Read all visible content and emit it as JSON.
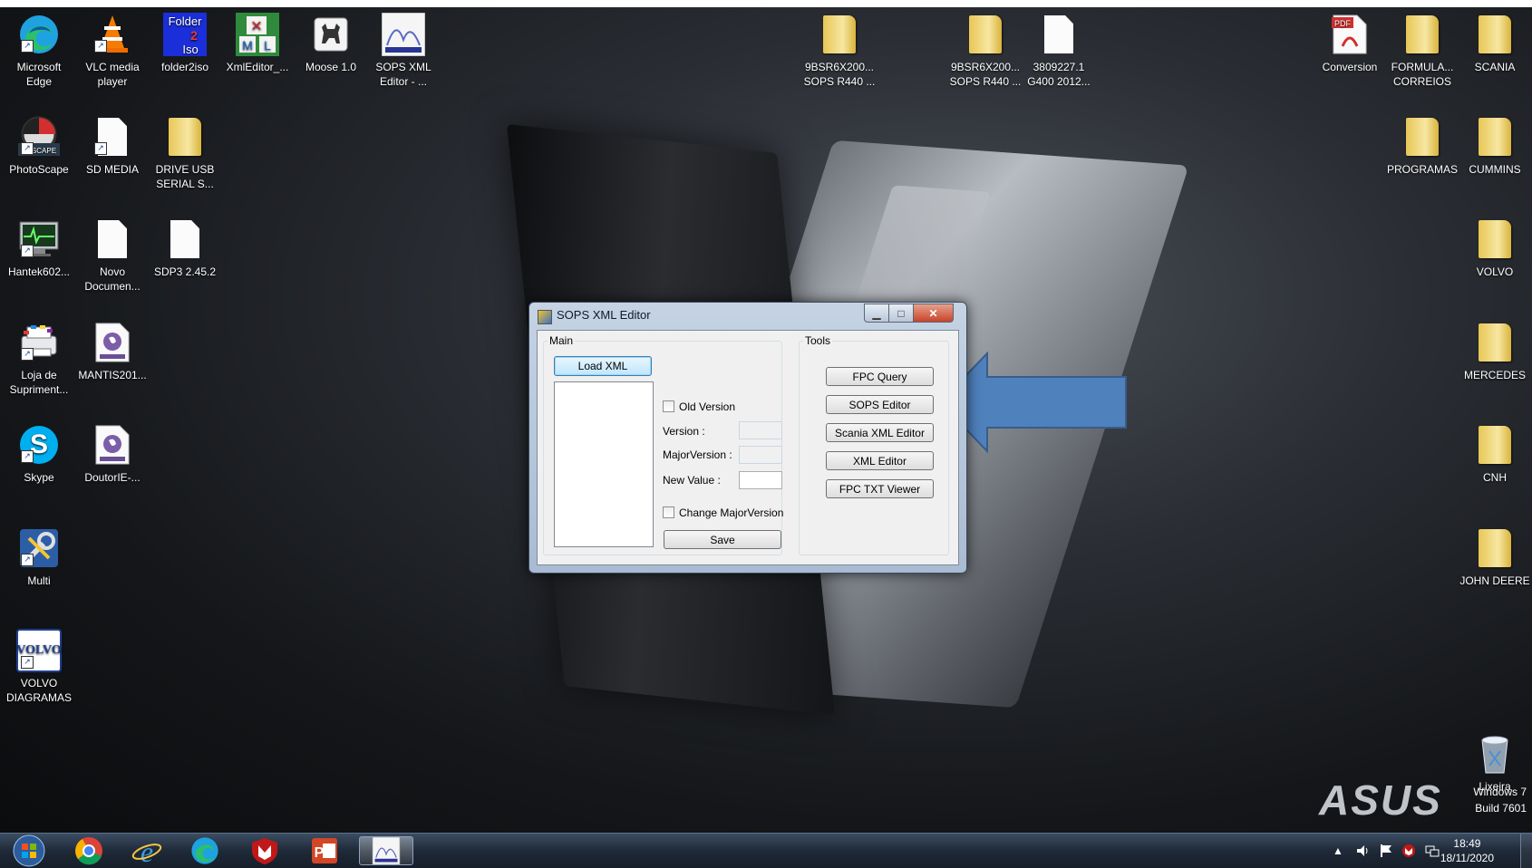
{
  "desktop": {
    "brand": "ASUS",
    "windows_info": [
      "Windows 7",
      "Build 7601"
    ],
    "icons": [
      {
        "label": "Microsoft\nEdge"
      },
      {
        "label": "VLC media\nplayer"
      },
      {
        "label": "folder2iso"
      },
      {
        "label": "XmlEditor_..."
      },
      {
        "label": "Moose 1.0"
      },
      {
        "label": "SOPS XML\nEditor - ..."
      },
      {
        "label": "PhotoScape"
      },
      {
        "label": "SD MEDIA"
      },
      {
        "label": "DRIVE USB\nSERIAL S..."
      },
      {
        "label": "Hantek602..."
      },
      {
        "label": "Novo\nDocumen..."
      },
      {
        "label": "SDP3 2.45.2"
      },
      {
        "label": "Loja de\nSupriment..."
      },
      {
        "label": "MANTIS201..."
      },
      {
        "label": "Skype"
      },
      {
        "label": "DoutorIE-..."
      },
      {
        "label": "Multi"
      },
      {
        "label": "VOLVO\nDIAGRAMAS"
      },
      {
        "label": "9BSR6X200...\nSOPS R440 ..."
      },
      {
        "label": "9BSR6X200...\nSOPS R440 ..."
      },
      {
        "label": "3809227.1\nG400 2012..."
      },
      {
        "label": "Conversion"
      },
      {
        "label": "FORMULA...\nCORREIOS"
      },
      {
        "label": "SCANIA"
      },
      {
        "label": "PROGRAMAS"
      },
      {
        "label": "CUMMINS"
      },
      {
        "label": "VOLVO"
      },
      {
        "label": "MERCEDES"
      },
      {
        "label": "CNH"
      },
      {
        "label": "JOHN DEERE"
      },
      {
        "label": "Lixeira"
      }
    ],
    "icon_glyphs": {
      "folder2iso_top": "Folder",
      "folder2iso_mid": "2",
      "folder2iso_bot": "Iso",
      "volvo_logo": "VOLVO",
      "pdf_badge": "PDF",
      "skype_letter": "S",
      "photoscape_text": "TOSCAPE"
    }
  },
  "dialog": {
    "title": "SOPS XML Editor",
    "window_controls": {
      "minimize": "▁",
      "maximize": "□",
      "close": "✕"
    },
    "main_group": {
      "label": "Main",
      "load_button": "Load XML",
      "old_version_label": "Old Version",
      "version_label": "Version :",
      "major_version_label": "MajorVersion :",
      "new_value_label": "New Value :",
      "change_major_label": "Change MajorVersion",
      "save_button": "Save"
    },
    "tools_group": {
      "label": "Tools",
      "buttons": [
        "FPC Query",
        "SOPS Editor",
        "Scania XML Editor",
        "XML Editor",
        "FPC TXT Viewer"
      ]
    }
  },
  "annotation": {
    "arrow_color": "#4f81bd",
    "arrow_border": "#385d8a"
  },
  "taskbar": {
    "clock_time": "18:49",
    "clock_date": "18/11/2020",
    "tray_expand": "▲",
    "apps": [
      "start-orb",
      "chrome",
      "internet-explorer",
      "edge",
      "mcafee",
      "powerpoint",
      "sops-xml-editor"
    ]
  }
}
